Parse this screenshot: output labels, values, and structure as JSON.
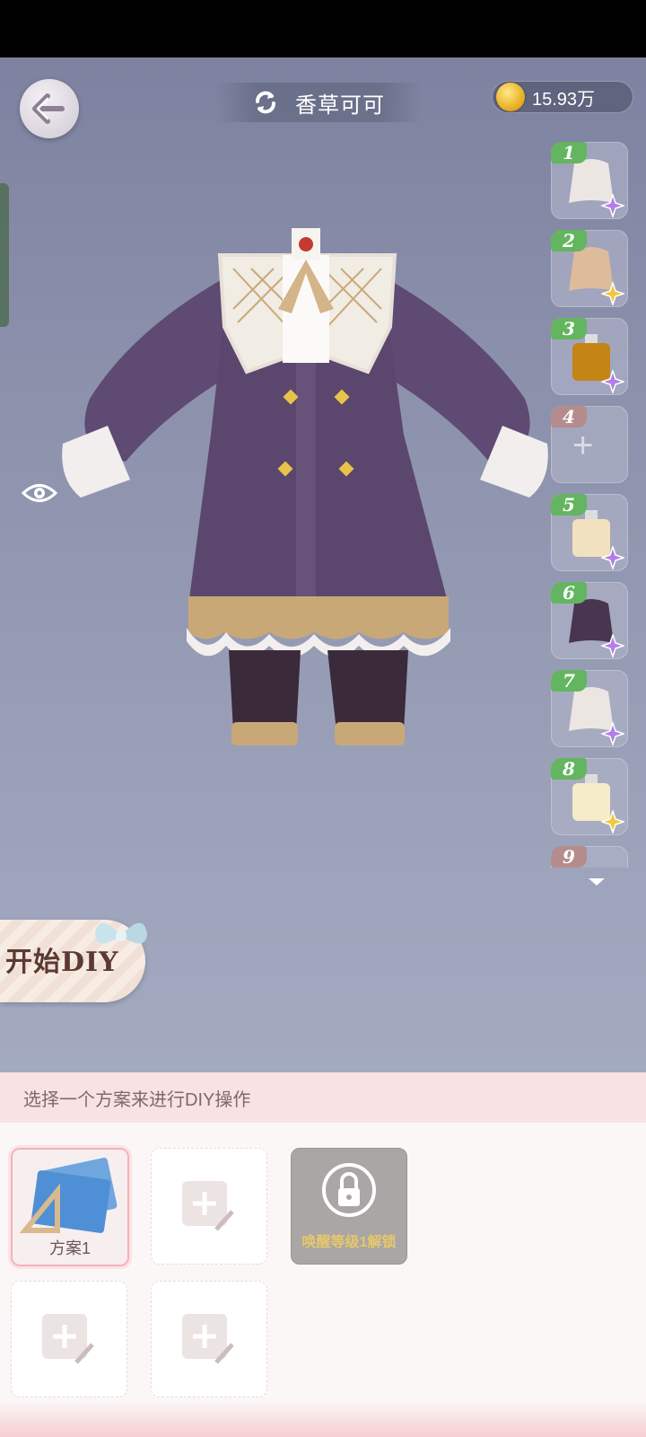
{
  "header": {
    "title": "香草可可",
    "coins": "15.93万"
  },
  "slots": [
    {
      "num": "1",
      "badge": "purple",
      "item": "cape-white"
    },
    {
      "num": "2",
      "badge": "yellow",
      "item": "cape-beige"
    },
    {
      "num": "3",
      "badge": "purple",
      "item": "bottle-amber"
    },
    {
      "num": "4",
      "badge": "",
      "item": "empty"
    },
    {
      "num": "5",
      "badge": "purple",
      "item": "bottle-cream"
    },
    {
      "num": "6",
      "badge": "purple",
      "item": "cape-plum"
    },
    {
      "num": "7",
      "badge": "purple",
      "item": "cape-white"
    },
    {
      "num": "8",
      "badge": "yellow",
      "item": "bottle-cream"
    },
    {
      "num": "9",
      "badge": "",
      "item": ""
    }
  ],
  "diy_button": "开始DIY",
  "panel": {
    "hint": "选择一个方案来进行DIY操作",
    "plans": [
      {
        "label": "方案1",
        "state": "selected"
      },
      {
        "label": "",
        "state": "empty"
      },
      {
        "label": "唤醒等级1解锁",
        "state": "locked"
      },
      {
        "label": "",
        "state": "empty"
      },
      {
        "label": "",
        "state": "empty"
      }
    ]
  },
  "colors": {
    "scene_bg": "#8f94ae",
    "garment_purple": "#5e4a72",
    "panel_header": "#f8e2e3",
    "slot_num_green": "#63b55f",
    "coin_gold": "#e6a915"
  }
}
